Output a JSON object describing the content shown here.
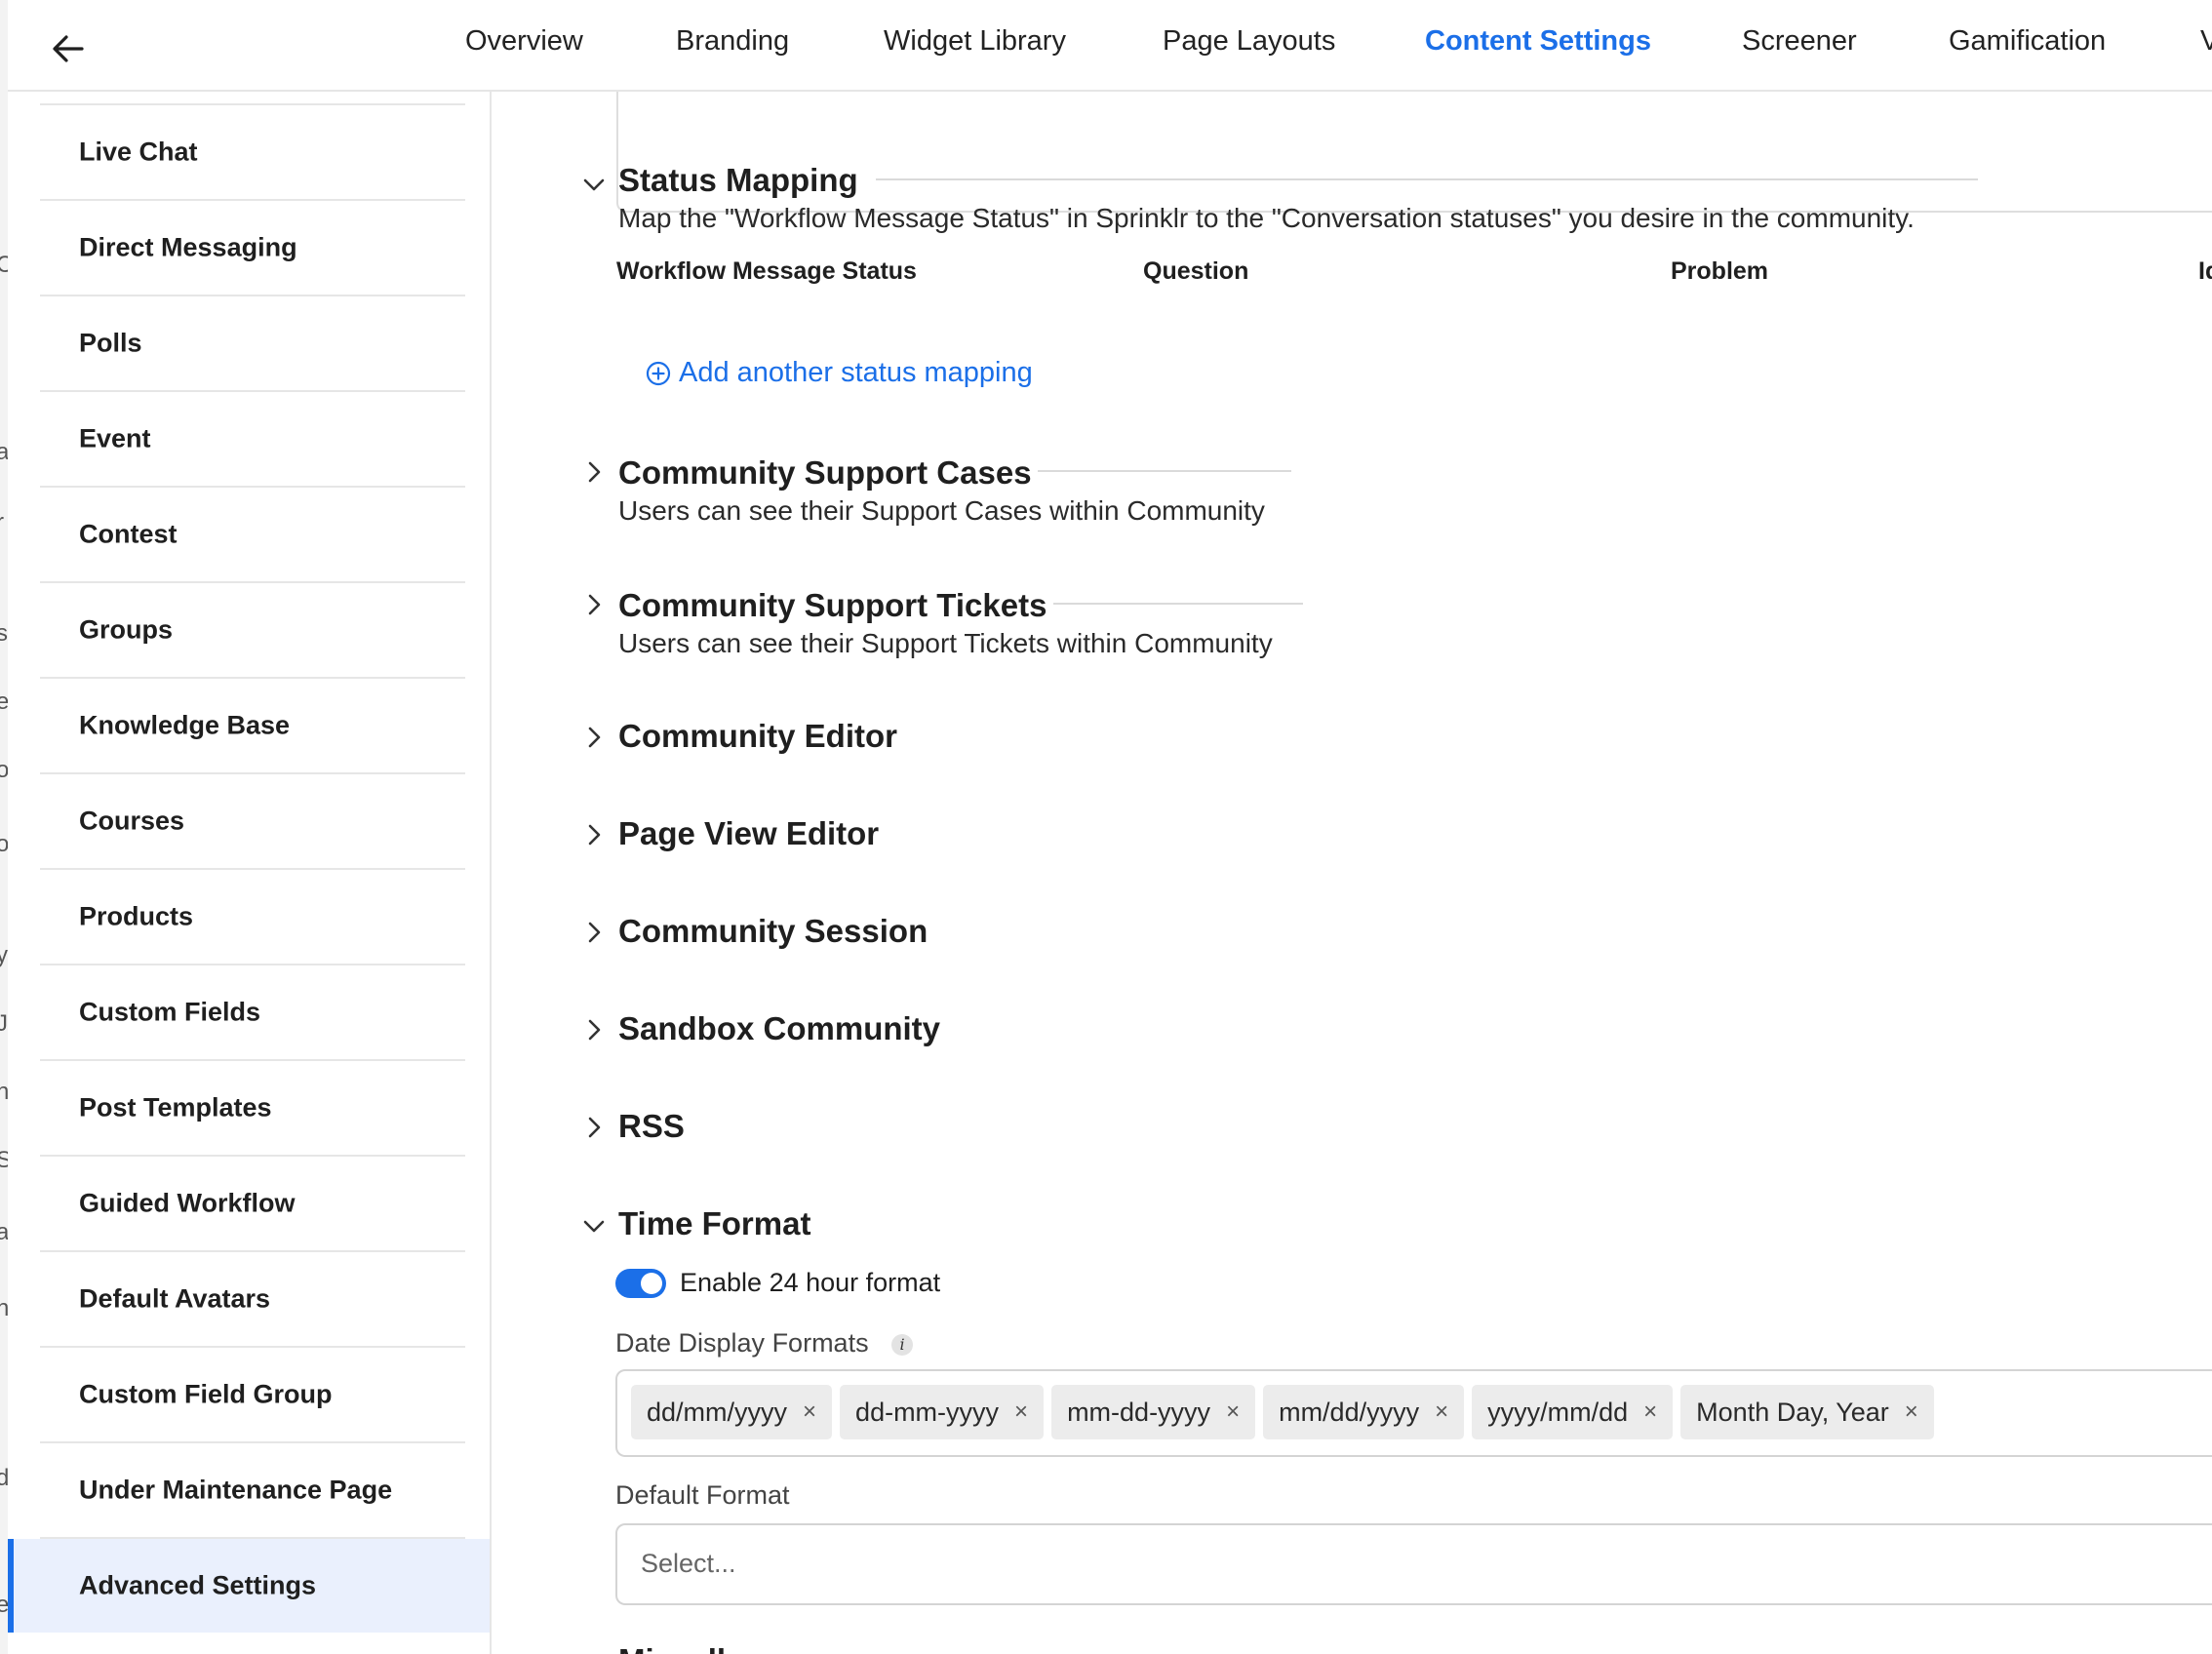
{
  "tabs": [
    {
      "label": "Overview",
      "active": false
    },
    {
      "label": "Branding",
      "active": false
    },
    {
      "label": "Widget Library",
      "active": false
    },
    {
      "label": "Page Layouts",
      "active": false
    },
    {
      "label": "Content Settings",
      "active": true
    },
    {
      "label": "Screener",
      "active": false
    },
    {
      "label": "Gamification",
      "active": false
    },
    {
      "label": "V",
      "active": false
    }
  ],
  "sidebar": {
    "items": [
      {
        "label": "Live Chat"
      },
      {
        "label": "Direct Messaging"
      },
      {
        "label": "Polls"
      },
      {
        "label": "Event"
      },
      {
        "label": "Contest"
      },
      {
        "label": "Groups"
      },
      {
        "label": "Knowledge Base"
      },
      {
        "label": "Courses"
      },
      {
        "label": "Products"
      },
      {
        "label": "Custom Fields"
      },
      {
        "label": "Post Templates"
      },
      {
        "label": "Guided Workflow"
      },
      {
        "label": "Default Avatars"
      },
      {
        "label": "Custom Field Group"
      },
      {
        "label": "Under Maintenance Page"
      },
      {
        "label": "Advanced Settings",
        "active": true
      }
    ]
  },
  "status_mapping": {
    "title": "Status Mapping",
    "description": "Map the \"Workflow Message Status\" in Sprinklr to the \"Conversation statuses\" you desire in the community.",
    "columns": [
      "Workflow Message Status",
      "Question",
      "Problem",
      "Id"
    ],
    "add_link": "Add another status mapping"
  },
  "sections": {
    "support_cases": {
      "title": "Community Support Cases",
      "description": "Users can see their Support Cases within Community"
    },
    "support_tickets": {
      "title": "Community Support Tickets",
      "description": "Users can see their Support Tickets within Community"
    },
    "editor": {
      "title": "Community Editor"
    },
    "page_view_editor": {
      "title": "Page View Editor"
    },
    "session": {
      "title": "Community Session"
    },
    "sandbox": {
      "title": "Sandbox Community"
    },
    "rss": {
      "title": "RSS"
    }
  },
  "time_format": {
    "title": "Time Format",
    "toggle_label": "Enable 24 hour format",
    "toggle_on": true,
    "date_formats_label": "Date Display Formats",
    "date_formats": [
      "dd/mm/yyyy",
      "dd-mm-yyyy",
      "mm-dd-yyyy",
      "mm/dd/yyyy",
      "yyyy/mm/dd",
      "Month Day, Year"
    ],
    "remove_symbol": "×",
    "default_format_label": "Default Format",
    "default_format_placeholder": "Select..."
  },
  "next_section_partial": "Miscell",
  "edge_letters": [
    "C",
    "a",
    "r",
    "s",
    "e",
    "o",
    "o",
    "y",
    "J",
    "n",
    "S",
    "a",
    "n",
    "d",
    "e"
  ],
  "colors": {
    "accent": "#1b6fe8",
    "active_bg": "#eaf0fd"
  }
}
